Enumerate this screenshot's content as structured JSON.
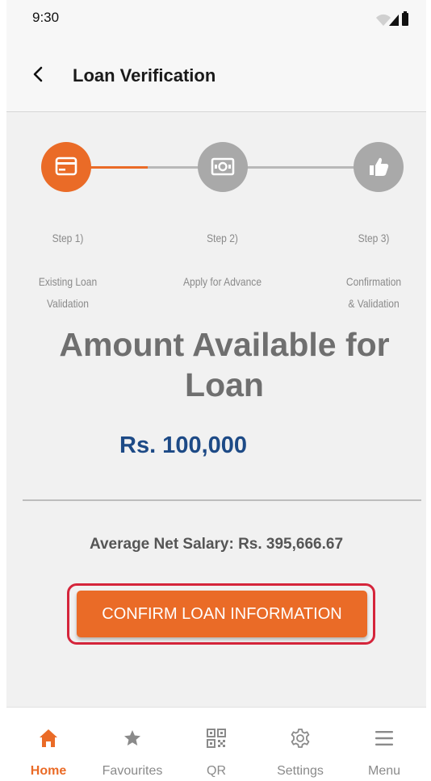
{
  "status_bar": {
    "time": "9:30"
  },
  "app_bar": {
    "title": "Loan Verification",
    "back_icon": "chevron-left-icon"
  },
  "stepper": {
    "steps": [
      {
        "number": "Step 1)",
        "label": "Existing Loan\nValidation",
        "icon": "card-icon",
        "state": "active"
      },
      {
        "number": "Step 2)",
        "label": "Apply for Advance",
        "icon": "cash-icon",
        "state": "inactive"
      },
      {
        "number": "Step 3)",
        "label": "Confirmation\n& Validation",
        "icon": "thumbs-up-icon",
        "state": "inactive"
      }
    ]
  },
  "amount": {
    "title": "Amount Available for Loan",
    "value": "Rs. 100,000"
  },
  "salary": {
    "text": "Average Net Salary: Rs. 395,666.67"
  },
  "confirm_button": {
    "label": "CONFIRM LOAN INFORMATION"
  },
  "bottom_nav": {
    "items": [
      {
        "label": "Home",
        "icon": "home-icon",
        "active": true
      },
      {
        "label": "Favourites",
        "icon": "star-icon",
        "active": false
      },
      {
        "label": "QR",
        "icon": "qr-code-icon",
        "active": false
      },
      {
        "label": "Settings",
        "icon": "gear-icon",
        "active": false
      },
      {
        "label": "Menu",
        "icon": "menu-icon",
        "active": false
      }
    ]
  },
  "colors": {
    "accent": "#ea6b27",
    "inactive_step": "#a9a9a9",
    "amount_value": "#1d4a86",
    "highlight_border": "#d5253b"
  }
}
